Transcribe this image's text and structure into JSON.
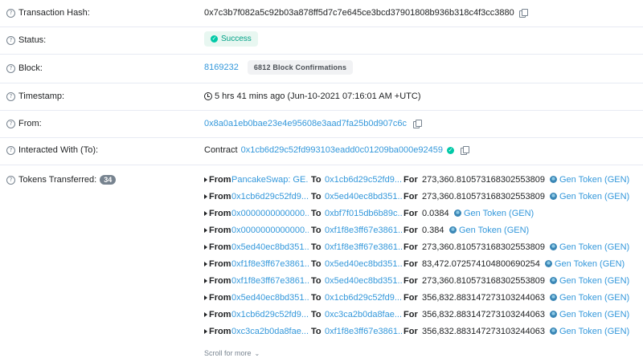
{
  "rows": {
    "tx_hash": {
      "label": "Transaction Hash:",
      "value": "0x7c3b7f082a5c92b03a878ff5d7c7e645ce3bcd37901808b936b318c4f3cc3880"
    },
    "status": {
      "label": "Status:",
      "value": "Success"
    },
    "block": {
      "label": "Block:",
      "number": "8169232",
      "confirmations": "6812 Block Confirmations"
    },
    "timestamp": {
      "label": "Timestamp:",
      "value": "5 hrs 41 mins ago (Jun-10-2021 07:16:01 AM +UTC)"
    },
    "from": {
      "label": "From:",
      "value": "0x8a0a1eb0bae23e4e95608e3aad7fa25b0d907c6c"
    },
    "interacted": {
      "label": "Interacted With (To):",
      "prefix": "Contract",
      "address": "0x1cb6d29c52fd993103eadd0c01209ba000e92459"
    },
    "tokens": {
      "label": "Tokens Transferred:",
      "count": "34"
    }
  },
  "transfer_labels": {
    "from": "From",
    "to": "To",
    "for": "For"
  },
  "transfers": [
    {
      "from": "PancakeSwap: GE...",
      "to": "0x1cb6d29c52fd9...",
      "amount": "273,360.810573168302553809",
      "token": "Gen Token (GEN)"
    },
    {
      "from": "0x1cb6d29c52fd9...",
      "to": "0x5ed40ec8bd351...",
      "amount": "273,360.810573168302553809",
      "token": "Gen Token (GEN)"
    },
    {
      "from": "0x0000000000000...",
      "to": "0xbf7f015db6b89c...",
      "amount": "0.0384",
      "token": "Gen Token (GEN)"
    },
    {
      "from": "0x0000000000000...",
      "to": "0xf1f8e3ff67e3861...",
      "amount": "0.384",
      "token": "Gen Token (GEN)"
    },
    {
      "from": "0x5ed40ec8bd351...",
      "to": "0xf1f8e3ff67e3861...",
      "amount": "273,360.810573168302553809",
      "token": "Gen Token (GEN)"
    },
    {
      "from": "0xf1f8e3ff67e3861...",
      "to": "0x5ed40ec8bd351...",
      "amount": "83,472.072574104800690254",
      "token": "Gen Token (GEN)"
    },
    {
      "from": "0xf1f8e3ff67e3861...",
      "to": "0x5ed40ec8bd351...",
      "amount": "273,360.810573168302553809",
      "token": "Gen Token (GEN)"
    },
    {
      "from": "0x5ed40ec8bd351...",
      "to": "0x1cb6d29c52fd9...",
      "amount": "356,832.883147273103244063",
      "token": "Gen Token (GEN)"
    },
    {
      "from": "0x1cb6d29c52fd9...",
      "to": "0xc3ca2b0da8fae...",
      "amount": "356,832.883147273103244063",
      "token": "Gen Token (GEN)"
    },
    {
      "from": "0xc3ca2b0da8fae...",
      "to": "0xf1f8e3ff67e3861...",
      "amount": "356,832.883147273103244063",
      "token": "Gen Token (GEN)"
    }
  ],
  "scroll_more": "Scroll for more",
  "icons": {
    "help": "question-circle-icon",
    "copy": "copy-icon",
    "clock": "clock-icon",
    "check": "check-circle-icon",
    "token": "gen-token-icon",
    "expand": "caret-right-icon",
    "scroll": "double-chevron-down-icon"
  },
  "colors": {
    "link": "#3498db",
    "success": "#00a186",
    "muted": "#77838f"
  }
}
